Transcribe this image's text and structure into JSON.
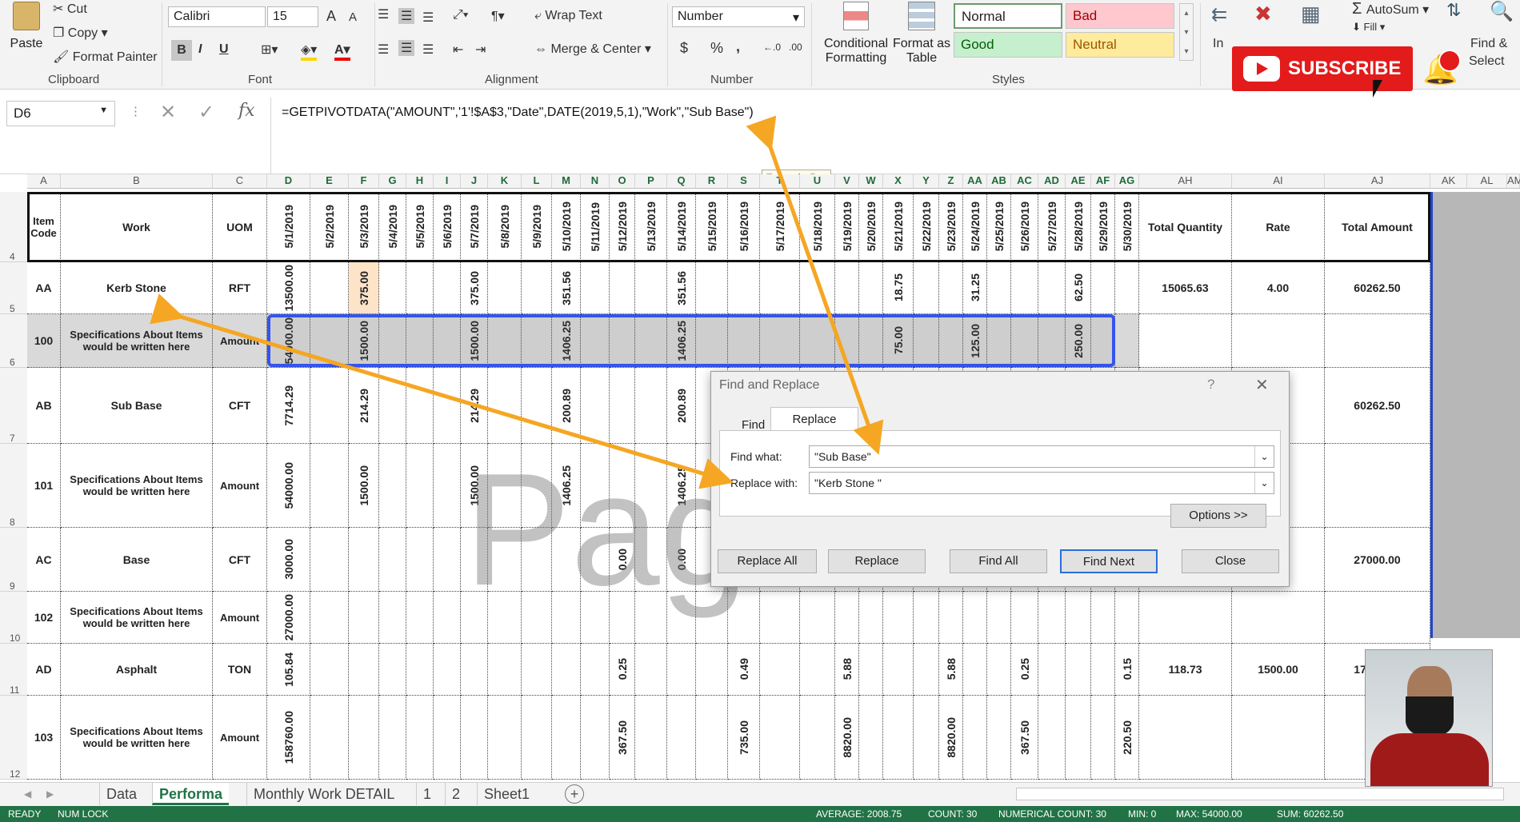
{
  "ribbon": {
    "clipboard": {
      "paste": "Paste",
      "cut": "Cut",
      "copy": "Copy",
      "format_painter": "Format Painter",
      "label": "Clipboard"
    },
    "font": {
      "name": "Calibri",
      "size": "15",
      "bold": "B",
      "italic": "I",
      "underline": "U",
      "grow": "A",
      "shrink": "A",
      "label": "Font"
    },
    "alignment": {
      "wrap_text": "Wrap Text",
      "merge_center": "Merge & Center",
      "label": "Alignment"
    },
    "number": {
      "format": "Number",
      "currency": "$",
      "percent": "%",
      "comma": ",",
      "label": "Number"
    },
    "styles": {
      "conditional": "Conditional",
      "conditional2": "Formatting",
      "format_as": "Format as",
      "format_as2": "Table",
      "normal": "Normal",
      "bad": "Bad",
      "good": "Good",
      "neutral": "Neutral",
      "label": "Styles"
    },
    "cells": {
      "insert": "In"
    },
    "editing": {
      "autosum": "AutoSum",
      "fill": "Fill",
      "find": "Find &",
      "select": "Select"
    },
    "subscribe": "SUBSCRIBE"
  },
  "formula_bar": {
    "name_box": "D6",
    "fx": "fx",
    "formula": "=GETPIVOTDATA(\"AMOUNT\",'1'!$A$3,\"Date\",DATE(2019,5,1),\"Work\",\"Sub Base\")",
    "tooltip": "Formula Bar"
  },
  "columns": {
    "letters": [
      "A",
      "B",
      "C",
      "D",
      "E",
      "F",
      "G",
      "H",
      "I",
      "J",
      "K",
      "L",
      "M",
      "N",
      "O",
      "P",
      "Q",
      "R",
      "S",
      "T",
      "U",
      "V",
      "W",
      "X",
      "Y",
      "Z",
      "AA",
      "AB",
      "AC",
      "AD",
      "AE",
      "AF",
      "AG",
      "AH",
      "AI",
      "AJ",
      "AK",
      "AL",
      "AM"
    ]
  },
  "header_row": {
    "item_code": "Item Code",
    "work": "Work",
    "uom": "UOM",
    "dates": [
      "5/1/2019",
      "5/2/2019",
      "5/3/2019",
      "5/4/2019",
      "5/5/2019",
      "5/6/2019",
      "5/7/2019",
      "5/8/2019",
      "5/9/2019",
      "5/10/2019",
      "5/11/2019",
      "5/12/2019",
      "5/13/2019",
      "5/14/2019",
      "5/15/2019",
      "5/16/2019",
      "5/17/2019",
      "5/18/2019",
      "5/19/2019",
      "5/20/2019",
      "5/21/2019",
      "5/22/2019",
      "5/23/2019",
      "5/24/2019",
      "5/25/2019",
      "5/26/2019",
      "5/27/2019",
      "5/28/2019",
      "5/29/2019",
      "5/30/2019"
    ],
    "total_qty": "Total Quantity",
    "rate": "Rate",
    "total_amt": "Total Amount"
  },
  "rows": [
    {
      "num": "4"
    },
    {
      "num": "5",
      "code": "AA",
      "work": "Kerb Stone",
      "uom": "RFT",
      "vals": {
        "0": "13500.00",
        "2": "375.00",
        "6": "375.00",
        "9": "351.56",
        "13": "351.56",
        "20": "18.75",
        "23": "31.25",
        "27": "62.50"
      },
      "total_qty": "15065.63",
      "rate": "4.00",
      "total_amt": "60262.50"
    },
    {
      "num": "6",
      "code": "100",
      "work": "Specifications About Items would be written here",
      "uom": "Amount",
      "vals": {
        "0": "54000.00",
        "2": "1500.00",
        "6": "1500.00",
        "9": "1406.25",
        "13": "1406.25",
        "20": "75.00",
        "23": "125.00",
        "27": "250.00"
      }
    },
    {
      "num": "7",
      "code": "AB",
      "work": "Sub Base",
      "uom": "CFT",
      "vals": {
        "0": "7714.29",
        "2": "214.29",
        "6": "214.29",
        "9": "200.89",
        "13": "200.89"
      },
      "total_amt": "60262.50"
    },
    {
      "num": "8",
      "code": "101",
      "work": "Specifications About Items would be written here",
      "uom": "Amount",
      "vals": {
        "0": "54000.00",
        "2": "1500.00",
        "6": "1500.00",
        "9": "1406.25",
        "13": "1406.25"
      }
    },
    {
      "num": "9",
      "code": "AC",
      "work": "Base",
      "uom": "CFT",
      "vals": {
        "0": "3000.00",
        "11": "0.00",
        "13": "0.00"
      },
      "total_amt": "27000.00"
    },
    {
      "num": "10",
      "code": "102",
      "work": "Specifications About Items would be written here",
      "uom": "Amount",
      "vals": {
        "0": "27000.00"
      }
    },
    {
      "num": "11",
      "code": "AD",
      "work": "Asphalt",
      "uom": "TON",
      "vals": {
        "0": "105.84",
        "11": "0.25",
        "15": "0.49",
        "18": "5.88",
        "22": "5.88",
        "25": "0.25",
        "29": "0.15"
      },
      "total_qty": "118.73",
      "rate": "1500.00",
      "total_amt": "178090.5"
    },
    {
      "num": "12",
      "code": "103",
      "work": "Specifications About Items would be written here",
      "uom": "Amount",
      "vals": {
        "0": "158760.00",
        "11": "367.50",
        "15": "735.00",
        "18": "8820.00",
        "22": "8820.00",
        "25": "367.50",
        "29": "220.50"
      }
    }
  ],
  "watermark": "Pag",
  "dialog": {
    "title": "Find and Replace",
    "help": "?",
    "close": "✕",
    "tab_find": "Find",
    "tab_replace": "Replace",
    "find_label": "Find what:",
    "find_value": "\"Sub Base\"",
    "replace_label": "Replace with:",
    "replace_value": "\"Kerb Stone \"",
    "options": "Options >>",
    "replace_all": "Replace All",
    "replace": "Replace",
    "find_all": "Find All",
    "find_next": "Find Next",
    "close_btn": "Close"
  },
  "sheet_tabs": [
    "Data",
    "Performa",
    "Monthly Work DETAIL",
    "1",
    "2",
    "Sheet1"
  ],
  "active_tab": "Performa",
  "status": {
    "ready": "READY",
    "numlock": "NUM LOCK",
    "average": "AVERAGE: 2008.75",
    "count": "COUNT: 30",
    "numcount": "NUMERICAL COUNT: 30",
    "min": "MIN: 0",
    "max": "MAX: 54000.00",
    "sum": "SUM: 60262.50"
  },
  "colors": {
    "accent": "#217346",
    "highlight": "#3355ee",
    "arrow": "#f5a623",
    "subscribe": "#e31b1b"
  }
}
